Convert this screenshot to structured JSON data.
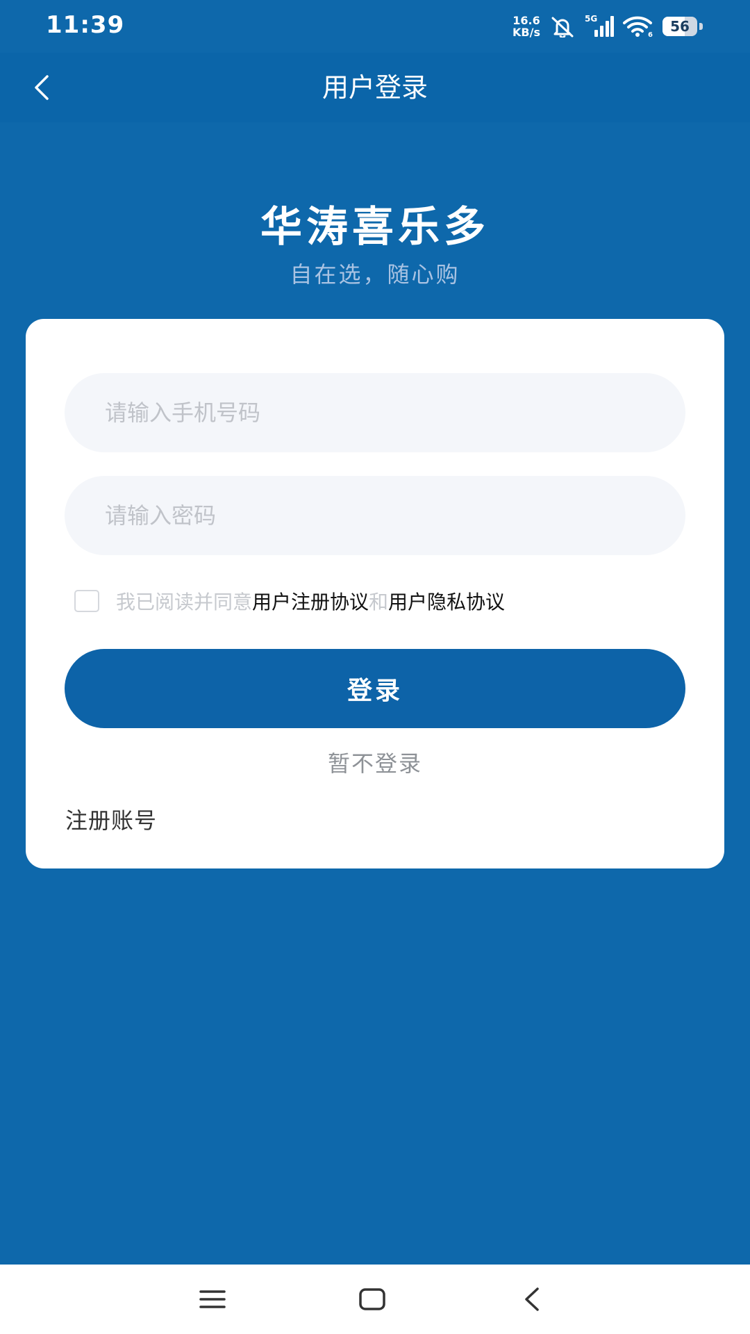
{
  "status_bar": {
    "time": "11:39",
    "network_speed_value": "16.6",
    "network_speed_unit": "KB/s",
    "network_type": "5G",
    "battery_level": "56",
    "icons": [
      "mute-icon",
      "signal-icon",
      "wifi-icon",
      "battery-icon"
    ]
  },
  "header": {
    "title": "用户登录",
    "back_icon": "chevron-left-icon"
  },
  "brand": {
    "name": "华涛喜乐多",
    "slogan": "自在选，随心购"
  },
  "form": {
    "phone_placeholder": "请输入手机号码",
    "phone_value": "",
    "password_placeholder": "请输入密码",
    "password_value": "",
    "agreement": {
      "checked": false,
      "prefix": "我已阅读并同意",
      "user_agreement": "用户注册协议",
      "conjunction": "和",
      "privacy_agreement": "用户隐私协议"
    },
    "login_label": "登录",
    "skip_label": "暂不登录",
    "register_label": "注册账号"
  },
  "nav_bar": {
    "icons": [
      "menu-icon",
      "home-icon",
      "back-icon"
    ]
  },
  "colors": {
    "background": "#0e68ab",
    "header": "#0b65a9",
    "primary_button": "#0d63a8",
    "card": "#ffffff",
    "input_bg": "#f4f6fa",
    "slogan": "#a9c3e3"
  }
}
